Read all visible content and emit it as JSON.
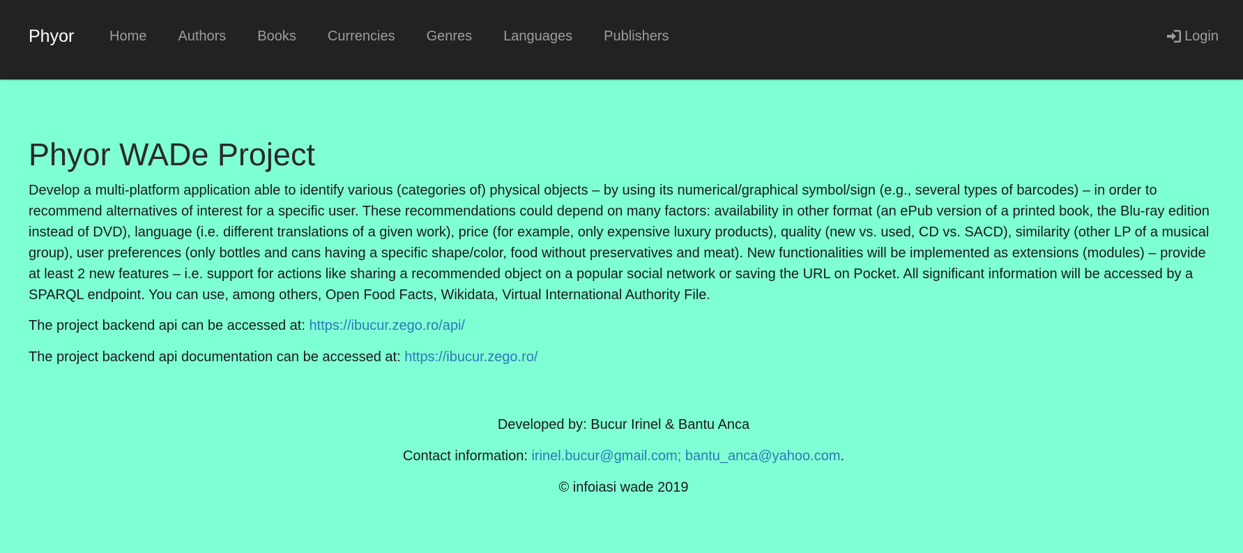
{
  "nav": {
    "brand": "Phyor",
    "items": [
      {
        "label": "Home"
      },
      {
        "label": "Authors"
      },
      {
        "label": "Books"
      },
      {
        "label": "Currencies"
      },
      {
        "label": "Genres"
      },
      {
        "label": "Languages"
      },
      {
        "label": "Publishers"
      }
    ],
    "login_label": "Login",
    "login_icon": "sign-in-icon"
  },
  "main": {
    "title": "Phyor WADe Project",
    "description": "Develop a multi-platform application able to identify various (categories of) physical objects – by using its numerical/graphical symbol/sign (e.g., several types of barcodes) – in order to recommend alternatives of interest for a specific user. These recommendations could depend on many factors: availability in other format (an ePub version of a printed book, the Blu-ray edition instead of DVD), language (i.e. different translations of a given work), price (for example, only expensive luxury products), quality (new vs. used, CD vs. SACD), similarity (other LP of a musical group), user preferences (only bottles and cans having a specific shape/color, food without preservatives and meat). New functionalities will be implemented as extensions (modules) – provide at least 2 new features – i.e. support for actions like sharing a recommended object on a popular social network or saving the URL on Pocket. All significant information will be accessed by a SPARQL endpoint. You can use, among others, Open Food Facts, Wikidata, Virtual International Authority File.",
    "api_text": "The project backend api can be accessed at: ",
    "api_link": "https://ibucur.zego.ro/api/",
    "docs_text": "The project backend api documentation can be accessed at: ",
    "docs_link": "https://ibucur.zego.ro/"
  },
  "footer": {
    "developed_by": "Developed by: Bucur Irinel & Bantu Anca",
    "contact_text": "Contact information: ",
    "email1": "irinel.bucur@gmail.com",
    "separator": ";",
    "email2": "bantu_anca@yahoo.com",
    "period": ".",
    "copyright": "© infoiasi wade 2019"
  },
  "colors": {
    "navbar_bg": "#222222",
    "page_bg": "#7fffd4",
    "link": "#2a7ab8",
    "nav_text": "#9d9d9d"
  }
}
